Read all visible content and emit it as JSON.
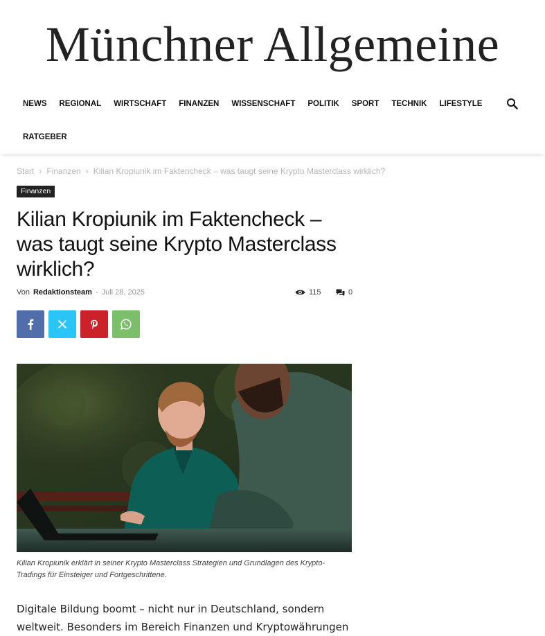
{
  "site": {
    "title": "Münchner Allgemeine"
  },
  "nav": {
    "items": [
      "NEWS",
      "REGIONAL",
      "WIRTSCHAFT",
      "FINANZEN",
      "WISSENSCHAFT",
      "POLITIK",
      "SPORT",
      "TECHNIK",
      "LIFESTYLE"
    ],
    "second_row": [
      "RATGEBER"
    ],
    "search_icon": "search-icon"
  },
  "breadcrumb": {
    "home": "Start",
    "category": "Finanzen",
    "current": "Kilian Kropiunik im Faktencheck – was taugt seine Krypto Masterclass wirklich?"
  },
  "article": {
    "category_badge": "Finanzen",
    "title": "Kilian Kropiunik im Faktencheck – was taugt seine Krypto Masterclass wirklich?",
    "byline_prefix": "Von",
    "author": "Redaktionsteam",
    "separator": "-",
    "date": "Juli 28, 2025",
    "views": "115",
    "comments": "0",
    "share": [
      {
        "name": "facebook",
        "color": "#516eab"
      },
      {
        "name": "x",
        "color": "#29c5f6"
      },
      {
        "name": "pinterest",
        "color": "#ca212a"
      },
      {
        "name": "whatsapp",
        "color": "#7bbf6a"
      }
    ],
    "caption": "Kilian Kropiunik erklärt in seiner Krypto Masterclass Strategien und Grundlagen des Krypto-Tradings für Einsteiger und Fortgeschrittene.",
    "body_lines": [
      "Digitale Bildung boomt – nicht nur in Deutschland, sondern",
      "weltweit. Besonders im Bereich Finanzen und Kryptowährungen"
    ]
  }
}
